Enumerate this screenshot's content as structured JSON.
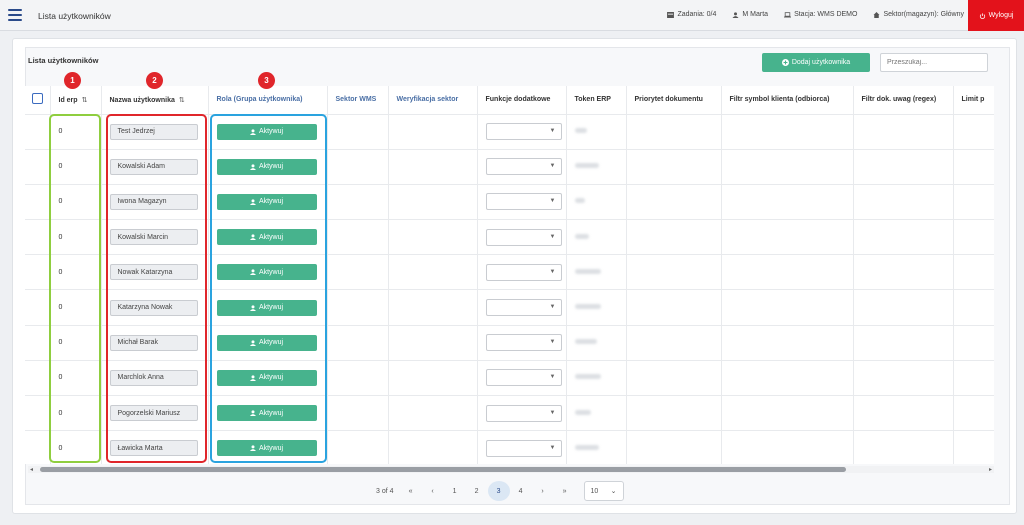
{
  "topbar": {
    "title": "Lista użytkowników",
    "tasks": "Zadania: 0/4",
    "user": "M Marta",
    "station": "Stacja: WMS DEMO",
    "sector": "Sektor(magazyn): Główny",
    "logout": "Wyloguj"
  },
  "main": {
    "list_title": "Lista użytkowników",
    "add_button": "Dodaj użytkownika",
    "search_placeholder": "Przeszukaj..."
  },
  "table": {
    "headers": {
      "id_erp": "Id erp",
      "name": "Nazwa użytkownika",
      "role": "Rola (Grupa użytkownika)",
      "sector_wms": "Sektor WMS",
      "verification": "Weryfikacja sektor",
      "functions": "Funkcje dodatkowe",
      "token": "Token ERP",
      "priority": "Priorytet dokumentu",
      "client_filter": "Filtr symbol klienta (odbiorca)",
      "notes_filter": "Filtr dok. uwag (regex)",
      "limit": "Limit p"
    },
    "sort_icon": "⇅",
    "role_button_label": "Aktywuj",
    "rows": [
      {
        "id": "0",
        "name": "Test Jedrzej"
      },
      {
        "id": "0",
        "name": "Kowalski Adam"
      },
      {
        "id": "0",
        "name": "Iwona Magazyn"
      },
      {
        "id": "0",
        "name": "Kowalski Marcin"
      },
      {
        "id": "0",
        "name": "Nowak Katarzyna"
      },
      {
        "id": "0",
        "name": "Katarzyna Nowak"
      },
      {
        "id": "0",
        "name": "Michał Barak"
      },
      {
        "id": "0",
        "name": "Marchlok Anna"
      },
      {
        "id": "0",
        "name": "Pogorzelski Mariusz"
      },
      {
        "id": "0",
        "name": "Ławicka Marta"
      }
    ]
  },
  "annotations": {
    "badge1": "1",
    "badge2": "2",
    "badge3": "3",
    "colors": {
      "green": "#8fce3f",
      "red": "#e0262b",
      "blue": "#2aa3df"
    }
  },
  "pagination": {
    "info": "3 of 4",
    "first": "«",
    "prev": "‹",
    "pages": [
      "1",
      "2",
      "3",
      "4"
    ],
    "active_page": "3",
    "next": "›",
    "last": "»",
    "per_page": "10"
  },
  "colors": {
    "accent": "#47b38d",
    "logout": "#e3121b",
    "nav": "#2a4a8a"
  }
}
